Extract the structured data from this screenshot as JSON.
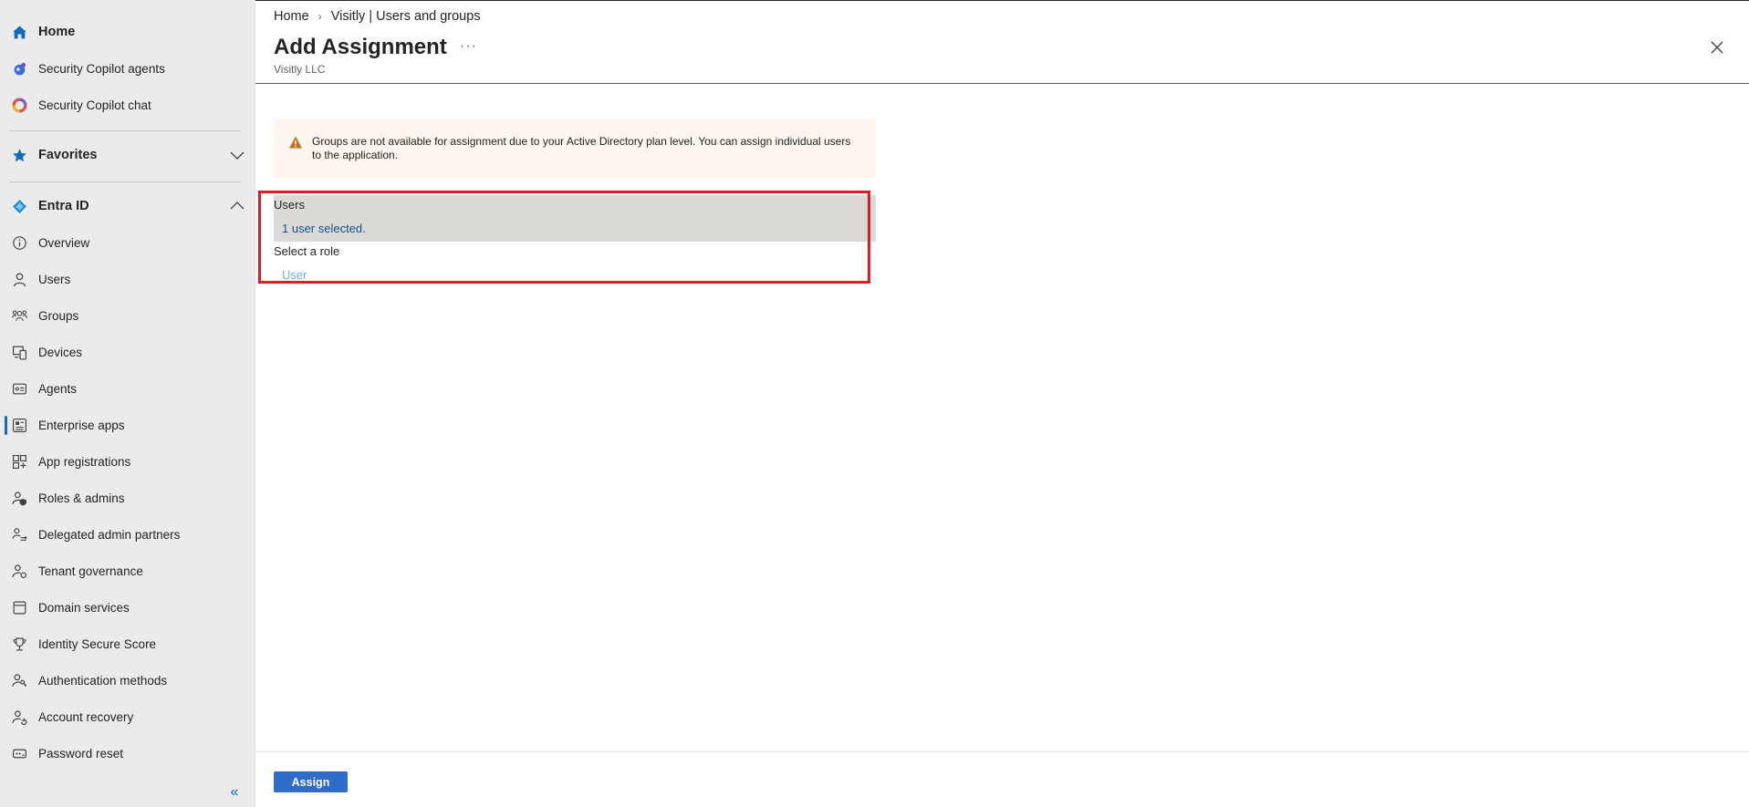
{
  "sidebar": {
    "home": {
      "label": "Home",
      "icon": "home-icon"
    },
    "copilot_agents": {
      "label": "Security Copilot agents",
      "icon": "copilot-agents-icon"
    },
    "copilot_chat": {
      "label": "Security Copilot chat",
      "icon": "copilot-chat-icon"
    },
    "favorites": {
      "label": "Favorites",
      "icon": "star-icon"
    },
    "entra": {
      "label": "Entra ID",
      "icon": "entra-id-icon"
    },
    "items": [
      {
        "label": "Overview",
        "icon": "info-icon"
      },
      {
        "label": "Users",
        "icon": "user-icon"
      },
      {
        "label": "Groups",
        "icon": "groups-icon"
      },
      {
        "label": "Devices",
        "icon": "devices-icon"
      },
      {
        "label": "Agents",
        "icon": "agents-icon"
      },
      {
        "label": "Enterprise apps",
        "icon": "enterprise-apps-icon",
        "active": true
      },
      {
        "label": "App registrations",
        "icon": "app-registrations-icon"
      },
      {
        "label": "Roles & admins",
        "icon": "roles-icon"
      },
      {
        "label": "Delegated admin partners",
        "icon": "delegated-admin-icon"
      },
      {
        "label": "Tenant governance",
        "icon": "tenant-governance-icon"
      },
      {
        "label": "Domain services",
        "icon": "domain-services-icon"
      },
      {
        "label": "Identity Secure Score",
        "icon": "trophy-icon"
      },
      {
        "label": "Authentication methods",
        "icon": "authentication-icon"
      },
      {
        "label": "Account recovery",
        "icon": "account-recovery-icon"
      },
      {
        "label": "Password reset",
        "icon": "password-reset-icon"
      }
    ],
    "collapse_label": "«"
  },
  "breadcrumb": {
    "home": "Home",
    "separator": "›",
    "current": "Visitly | Users and groups"
  },
  "header": {
    "title": "Add Assignment",
    "more": "···",
    "subtitle": "Visitly LLC"
  },
  "warning": {
    "text": "Groups are not available for assignment due to your Active Directory plan level. You can assign individual users to the application."
  },
  "form": {
    "users_label": "Users",
    "users_value": "1 user selected.",
    "role_label": "Select a role",
    "role_value": "User"
  },
  "footer": {
    "assign_label": "Assign"
  },
  "colors": {
    "accent": "#0f6cbd",
    "button": "#2f6bc9",
    "highlight_outline": "#e01c24",
    "warning_bg": "#fdf6ee",
    "warning_icon": "#c7711a"
  }
}
